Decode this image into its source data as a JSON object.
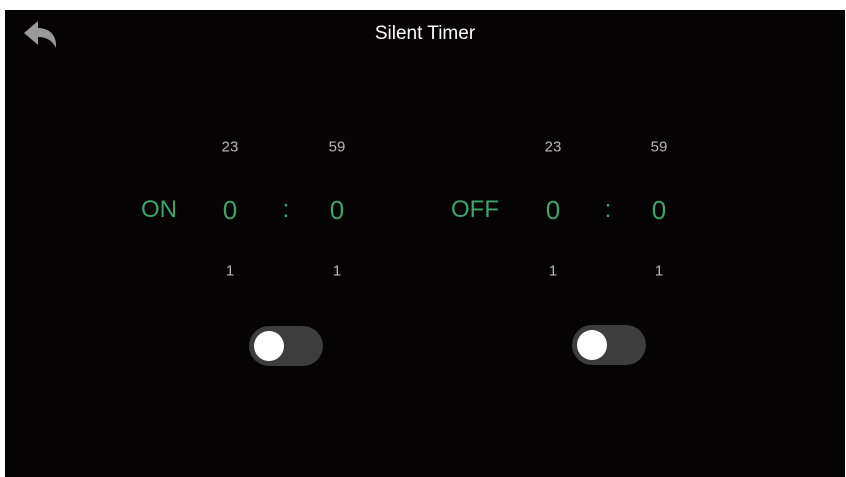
{
  "header": {
    "title": "Silent Timer",
    "back_icon": "back-arrow-icon"
  },
  "on_timer": {
    "label": "ON",
    "hour": {
      "above": "23",
      "value": "0",
      "below": "1"
    },
    "separator": ":",
    "minute": {
      "above": "59",
      "value": "0",
      "below": "1"
    },
    "toggle_on": false
  },
  "off_timer": {
    "label": "OFF",
    "hour": {
      "above": "23",
      "value": "0",
      "below": "1"
    },
    "separator": ":",
    "minute": {
      "above": "59",
      "value": "0",
      "below": "1"
    },
    "toggle_on": false
  },
  "colors": {
    "background": "#050303",
    "accent": "#3fa36e",
    "muted_text": "#b8b8b8",
    "toggle_track": "#3d3d3d",
    "toggle_knob": "#ffffff"
  }
}
